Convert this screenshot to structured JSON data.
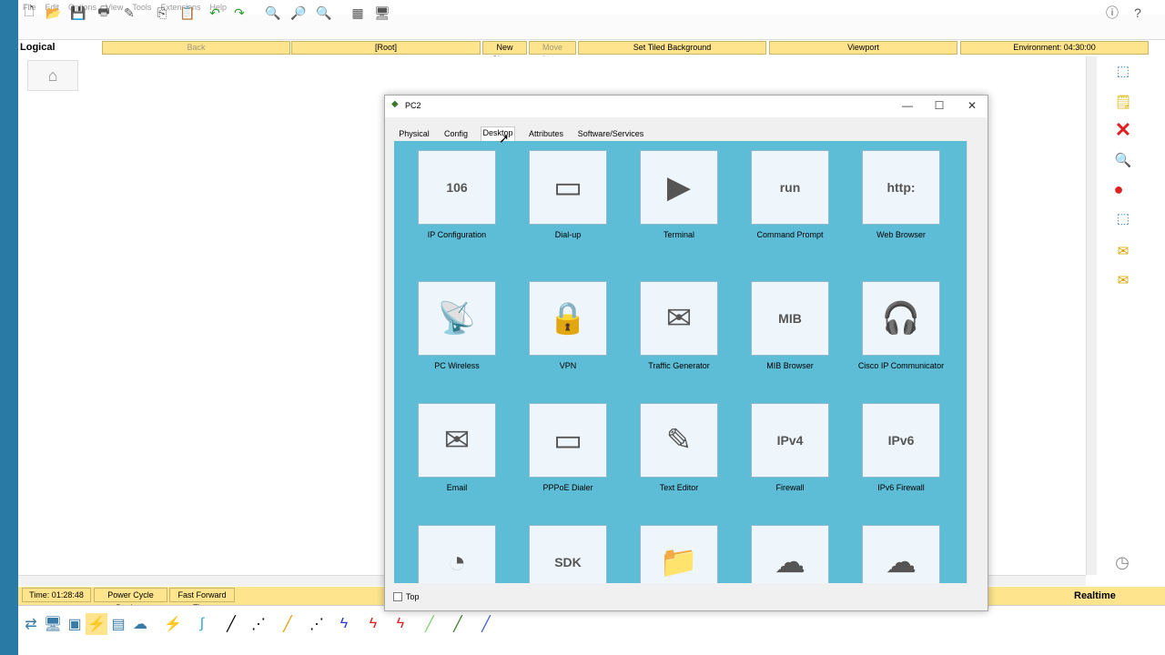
{
  "menu": [
    "File",
    "Edit",
    "Options",
    "View",
    "Tools",
    "Extensions",
    "Help"
  ],
  "logical": {
    "label": "Logical",
    "back": "Back",
    "root": "[Root]",
    "new_cluster": "New Cluster",
    "move_object": "Move Object",
    "set_tiled_bg": "Set Tiled Background",
    "viewport": "Viewport",
    "environment": "Environment: 04:30:00"
  },
  "window": {
    "title": "PC2",
    "tabs": [
      "Physical",
      "Config",
      "Desktop",
      "Attributes",
      "Software/Services"
    ],
    "active_tab": "Desktop",
    "apps": [
      {
        "label": "IP Configuration",
        "icon": "ip-config-icon",
        "glyph": "106"
      },
      {
        "label": "Dial-up",
        "icon": "modem-icon",
        "glyph": "▭"
      },
      {
        "label": "Terminal",
        "icon": "terminal-icon",
        "glyph": "▶"
      },
      {
        "label": "Command Prompt",
        "icon": "command-prompt-icon",
        "glyph": "run"
      },
      {
        "label": "Web Browser",
        "icon": "web-browser-icon",
        "glyph": "http:"
      },
      {
        "label": "PC Wireless",
        "icon": "wireless-icon",
        "glyph": "📡"
      },
      {
        "label": "VPN",
        "icon": "vpn-icon",
        "glyph": "🔒"
      },
      {
        "label": "Traffic Generator",
        "icon": "traffic-generator-icon",
        "glyph": "✉"
      },
      {
        "label": "MIB Browser",
        "icon": "mib-browser-icon",
        "glyph": "MIB"
      },
      {
        "label": "Cisco IP Communicator",
        "icon": "ip-communicator-icon",
        "glyph": "🎧"
      },
      {
        "label": "Email",
        "icon": "email-icon",
        "glyph": "✉"
      },
      {
        "label": "PPPoE Dialer",
        "icon": "pppoe-icon",
        "glyph": "▭"
      },
      {
        "label": "Text Editor",
        "icon": "text-editor-icon",
        "glyph": "✎"
      },
      {
        "label": "Firewall",
        "icon": "firewall-icon",
        "glyph": "IPv4"
      },
      {
        "label": "IPv6 Firewall",
        "icon": "ipv6-firewall-icon",
        "glyph": "IPv6"
      },
      {
        "label": "",
        "icon": "pie-chart-icon",
        "glyph": "◔"
      },
      {
        "label": "",
        "icon": "sdk-icon",
        "glyph": "SDK"
      },
      {
        "label": "",
        "icon": "folder-icon",
        "glyph": "📁"
      },
      {
        "label": "",
        "icon": "cloud-device-icon",
        "glyph": "☁"
      },
      {
        "label": "",
        "icon": "cloud-device-icon-2",
        "glyph": "☁"
      }
    ],
    "top_checkbox": "Top"
  },
  "bottom": {
    "time": "Time: 01:28:48",
    "power_cycle": "Power Cycle Devices",
    "fast_forward": "Fast Forward Time",
    "mode": "Realtime"
  }
}
